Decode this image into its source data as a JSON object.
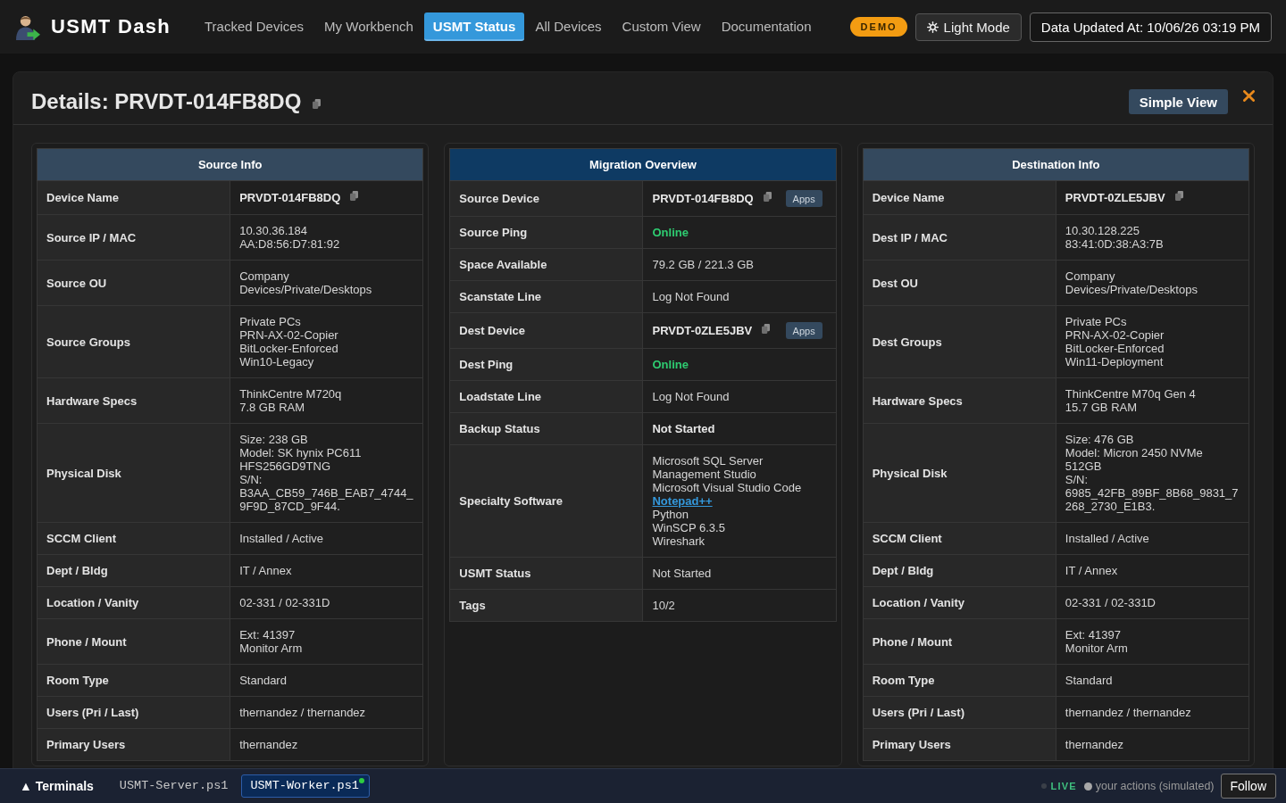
{
  "header": {
    "brand": "USMT Dash",
    "nav": [
      {
        "label": "Tracked Devices",
        "selected": false
      },
      {
        "label": "My Workbench",
        "selected": false
      },
      {
        "label": "USMT Status",
        "selected": true
      },
      {
        "label": "All Devices",
        "selected": false
      },
      {
        "label": "Custom View",
        "selected": false
      },
      {
        "label": "Documentation",
        "selected": false
      }
    ],
    "badge": "DEMO",
    "theme_button": "Light Mode",
    "updated": "Data Updated At: 10/06/26 03:19 PM"
  },
  "details": {
    "title": "Details: PRVDT-014FB8DQ",
    "simple_view_button": "Simple View"
  },
  "panels": [
    {
      "title": "Source Info",
      "kind": "info",
      "rows": [
        {
          "label": "Device Name",
          "kind": "device",
          "lines": [
            "PRVDT-014FB8DQ"
          ]
        },
        {
          "label": "Source IP / MAC",
          "kind": "text",
          "lines": [
            "10.30.36.184",
            "AA:D8:56:D7:81:92"
          ]
        },
        {
          "label": "Source OU",
          "kind": "text",
          "lines": [
            "Company Devices/Private/Desktops"
          ]
        },
        {
          "label": "Source Groups",
          "kind": "text",
          "lines": [
            "Private PCs",
            "PRN-AX-02-Copier",
            "BitLocker-Enforced",
            "Win10-Legacy"
          ]
        },
        {
          "label": "Hardware Specs",
          "kind": "text",
          "lines": [
            "ThinkCentre M720q",
            "7.8 GB RAM"
          ]
        },
        {
          "label": "Physical Disk",
          "kind": "text",
          "lines": [
            "Size: 238 GB",
            "Model: SK hynix PC611 HFS256GD9TNG",
            "S/N: B3AA_CB59_746B_EAB7_4744_9F9D_87CD_9F44."
          ]
        },
        {
          "label": "SCCM Client",
          "kind": "text",
          "lines": [
            "Installed / Active"
          ]
        },
        {
          "label": "Dept / Bldg",
          "kind": "text",
          "lines": [
            "IT / Annex"
          ]
        },
        {
          "label": "Location / Vanity",
          "kind": "text",
          "lines": [
            "02-331 / 02-331D"
          ]
        },
        {
          "label": "Phone / Mount",
          "kind": "text",
          "lines": [
            "Ext: 41397",
            "Monitor Arm"
          ]
        },
        {
          "label": "Room Type",
          "kind": "text",
          "lines": [
            "Standard"
          ]
        },
        {
          "label": "Users (Pri / Last)",
          "kind": "text",
          "lines": [
            "thernandez / thernandez"
          ]
        },
        {
          "label": "Primary Users",
          "kind": "text",
          "lines": [
            "thernandez"
          ]
        }
      ]
    },
    {
      "title": "Migration Overview",
      "kind": "overview",
      "rows": [
        {
          "label": "Source Device",
          "kind": "device",
          "lines": [
            "PRVDT-014FB8DQ"
          ],
          "apps": "Apps"
        },
        {
          "label": "Source Ping",
          "kind": "online",
          "lines": [
            "Online"
          ]
        },
        {
          "label": "Space Available",
          "kind": "text",
          "lines": [
            "79.2 GB / 221.3 GB"
          ]
        },
        {
          "label": "Scanstate Line",
          "kind": "text",
          "lines": [
            "Log Not Found"
          ]
        },
        {
          "label": "Dest Device",
          "kind": "device",
          "lines": [
            "PRVDT-0ZLE5JBV"
          ],
          "apps": "Apps"
        },
        {
          "label": "Dest Ping",
          "kind": "online",
          "lines": [
            "Online"
          ]
        },
        {
          "label": "Loadstate Line",
          "kind": "text",
          "lines": [
            "Log Not Found"
          ]
        },
        {
          "label": "Backup Status",
          "kind": "strong",
          "lines": [
            "Not Started"
          ]
        },
        {
          "label": "Specialty Software",
          "kind": "software",
          "items": [
            {
              "text": "Microsoft SQL Server Management Studio",
              "kind": "text"
            },
            {
              "text": "Microsoft Visual Studio Code",
              "kind": "text"
            },
            {
              "text": "Notepad++",
              "kind": "link"
            },
            {
              "text": "Python",
              "kind": "text"
            },
            {
              "text": "WinSCP 6.3.5",
              "kind": "text"
            },
            {
              "text": "Wireshark",
              "kind": "text"
            }
          ]
        },
        {
          "label": "USMT Status",
          "kind": "text",
          "lines": [
            "Not Started"
          ]
        },
        {
          "label": "Tags",
          "kind": "text",
          "lines": [
            "10/2"
          ]
        }
      ]
    },
    {
      "title": "Destination Info",
      "kind": "info",
      "rows": [
        {
          "label": "Device Name",
          "kind": "device",
          "lines": [
            "PRVDT-0ZLE5JBV"
          ]
        },
        {
          "label": "Dest IP / MAC",
          "kind": "text",
          "lines": [
            "10.30.128.225",
            "83:41:0D:38:A3:7B"
          ]
        },
        {
          "label": "Dest OU",
          "kind": "text",
          "lines": [
            "Company Devices/Private/Desktops"
          ]
        },
        {
          "label": "Dest Groups",
          "kind": "text",
          "lines": [
            "Private PCs",
            "PRN-AX-02-Copier",
            "BitLocker-Enforced",
            "Win11-Deployment"
          ]
        },
        {
          "label": "Hardware Specs",
          "kind": "text",
          "lines": [
            "ThinkCentre M70q Gen 4",
            "15.7 GB RAM"
          ]
        },
        {
          "label": "Physical Disk",
          "kind": "text",
          "lines": [
            "Size: 476 GB",
            "Model: Micron 2450 NVMe 512GB",
            "S/N: 6985_42FB_89BF_8B68_9831_7268_2730_E1B3."
          ]
        },
        {
          "label": "SCCM Client",
          "kind": "text",
          "lines": [
            "Installed / Active"
          ]
        },
        {
          "label": "Dept / Bldg",
          "kind": "text",
          "lines": [
            "IT / Annex"
          ]
        },
        {
          "label": "Location / Vanity",
          "kind": "text",
          "lines": [
            "02-331 / 02-331D"
          ]
        },
        {
          "label": "Phone / Mount",
          "kind": "text",
          "lines": [
            "Ext: 41397",
            "Monitor Arm"
          ]
        },
        {
          "label": "Room Type",
          "kind": "text",
          "lines": [
            "Standard"
          ]
        },
        {
          "label": "Users (Pri / Last)",
          "kind": "text",
          "lines": [
            "thernandez / thernandez"
          ]
        },
        {
          "label": "Primary Users",
          "kind": "text",
          "lines": [
            "thernandez"
          ]
        }
      ]
    }
  ],
  "terminal_bar": {
    "toggle": "▲ Terminals",
    "tabs": [
      {
        "label": "USMT-Server.ps1",
        "selected": false,
        "running": false
      },
      {
        "label": "USMT-Worker.ps1",
        "selected": true,
        "running": true
      }
    ],
    "live": "LIVE",
    "activity": "your actions (simulated)",
    "follow_button": "Follow"
  }
}
